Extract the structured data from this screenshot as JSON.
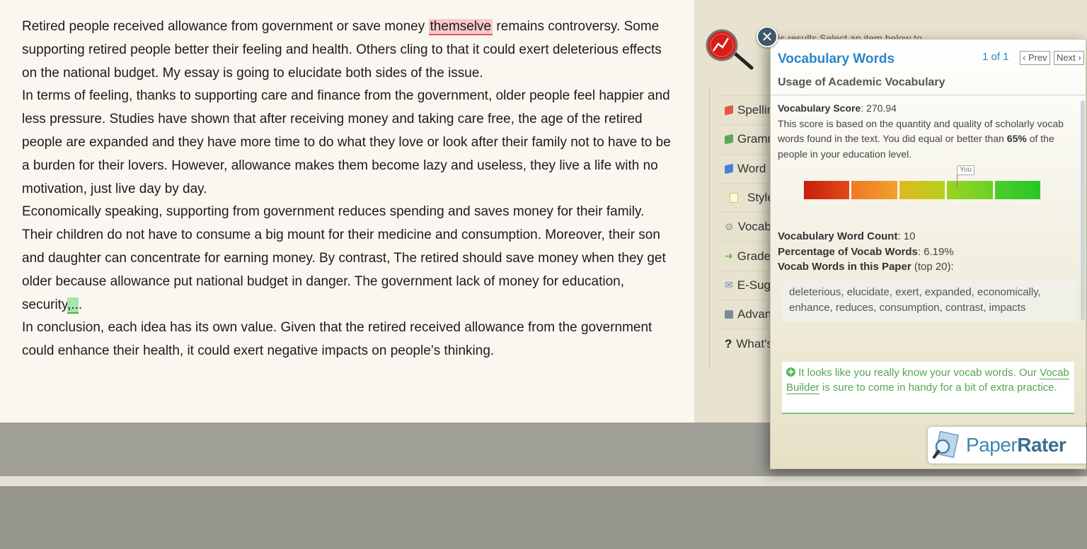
{
  "essay": {
    "p1_a": "Retired people received allowance from government or save money ",
    "p1_err": "themselve",
    "p1_b": " remains controversy. Some supporting retired people better their feeling and health. Others cling to that it could exert deleterious effects on the national budget. My essay is going to elucidate both sides of the issue.",
    "p2": "In terms of feeling, thanks to supporting care and finance from the government, older people feel happier and less pressure. Studies have shown that after receiving money and taking care free, the age of the retired people are expanded and they have more time to do what they love or look after their family not to have to be a burden for their lovers. However, allowance makes them become lazy and useless, they live a life with no motivation, just live day by day.",
    "p3_a": "Economically speaking, supporting from government reduces spending and saves money for their family. Their children do not have to consume a big mount for their medicine and consumption. Moreover, their son and daughter can concentrate for earning money. By contrast, The retired should save money when they get older because allowance put national budget in danger. The government lack of money for education, security",
    "p3_mark": ",..",
    "p3_b": ".",
    "p4": "In conclusion, each idea has its own value. Given that the retired received allowance from the government could enhance their health, it could exert negative impacts on people’s thinking."
  },
  "behind_title": "lysis results  Select an item below to",
  "menu": [
    {
      "label": "Spelling",
      "icon": "red-flag-icon",
      "color": "#e05a4a"
    },
    {
      "label": "Grammar",
      "icon": "green-flag-icon",
      "color": "#5aaa55"
    },
    {
      "label": "Word Choice",
      "icon": "blue-flag-icon",
      "color": "#4a7fd8"
    },
    {
      "label": "Style",
      "icon": "document-icon",
      "color": "#f2e2a0"
    },
    {
      "label": "Vocabulary Words",
      "icon": "gear-icon",
      "color": "#999999"
    },
    {
      "label": "Grade Level",
      "icon": "arrow-right-icon",
      "color": "#6cb84a"
    },
    {
      "label": "E-Suggestions",
      "icon": "mail-icon",
      "color": "#6d8fc0"
    },
    {
      "label": "Advanced",
      "icon": "add-icon",
      "color": "#5a8a5a"
    },
    {
      "label": "What's Next?",
      "icon": "question-icon",
      "color": "#222222"
    }
  ],
  "popup": {
    "close": "✕",
    "title": "Vocabulary Words",
    "page": "1 of 1",
    "prev": "‹ Prev",
    "next": "Next ›",
    "subtitle": "Usage of Academic Vocabulary",
    "score_label": "Vocabulary Score",
    "score_value": ": 270.94",
    "desc_a": "This score is based on the quantity and quality of scholarly vocab words found in the text. You did equal or better than ",
    "desc_pct": "65%",
    "desc_b": " of the people in your education level.",
    "you_label": "You",
    "percentile": 65,
    "meter_colors": [
      "#d42a10",
      "#f08a2a",
      "#c8d020",
      "#7ed42a",
      "#2ecf2a"
    ],
    "count_label": "Vocabulary Word Count",
    "count_value": ": 10",
    "pct_label": "Percentage of Vocab Words",
    "pct_value": ": 6.19%",
    "list_label": "Vocab Words in this Paper",
    "list_note": " (top 20):",
    "words": "deleterious, elucidate, exert, expanded, economically, enhance, reduces, consumption, contrast, impacts",
    "tip_plus": "+",
    "tip_a": " It looks like you really know your vocab words. Our ",
    "tip_link": "Vocab Builder",
    "tip_b": " is sure to come in handy for a bit of extra practice.",
    "brand_a": "Paper",
    "brand_b": "Rater"
  }
}
